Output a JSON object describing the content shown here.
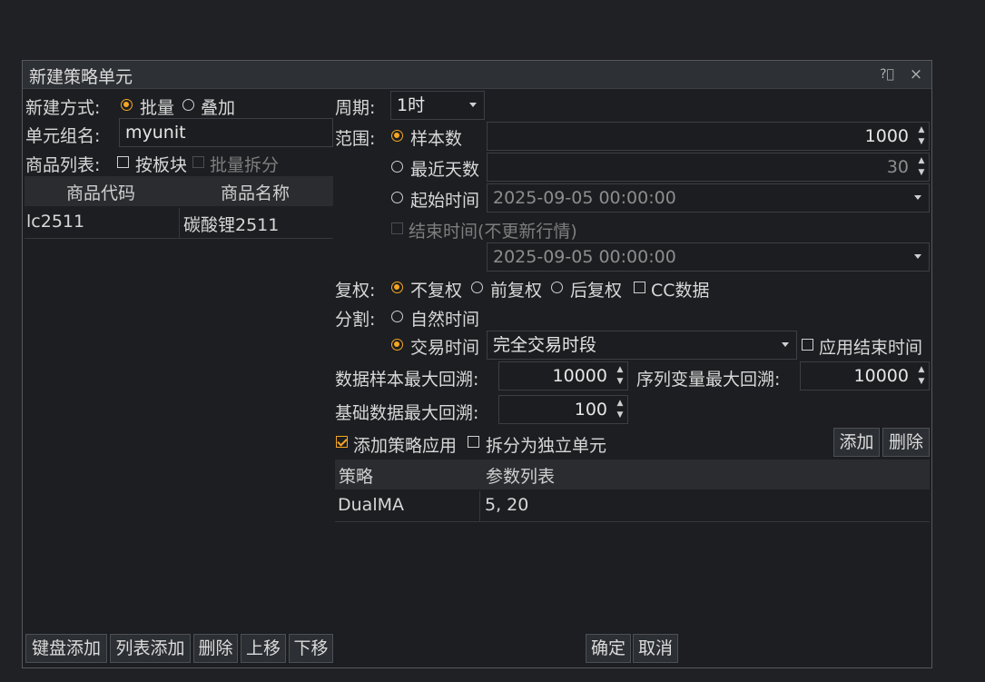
{
  "dialog": {
    "title": "新建策略单元"
  },
  "left": {
    "create_mode_label": "新建方式:",
    "mode_batch": "批量",
    "mode_overlay": "叠加",
    "unit_group_label": "单元组名:",
    "unit_group_value": "myunit",
    "product_list_label": "商品列表:",
    "by_sector_label": "按板块",
    "batch_split_label": "批量拆分",
    "table_headers": [
      "商品代码",
      "商品名称"
    ],
    "rows": [
      {
        "code": "lc2511",
        "name": "碳酸锂2511"
      }
    ],
    "buttons": {
      "keyboard_add": "键盘添加",
      "list_add": "列表添加",
      "delete": "删除",
      "move_up": "上移",
      "move_down": "下移"
    }
  },
  "right": {
    "period_label": "周期:",
    "period_value": "1时",
    "range_label": "范围:",
    "sample_count_label": "样本数",
    "sample_count_value": "1000",
    "recent_days_label": "最近天数",
    "recent_days_value": "30",
    "start_time_label": "起始时间",
    "start_time_value": "2025-09-05 00:00:00",
    "end_time_label": "结束时间(不更新行情)",
    "end_time_value": "2025-09-05 00:00:00",
    "adjust_label": "复权:",
    "no_adjust": "不复权",
    "pre_adjust": "前复权",
    "post_adjust": "后复权",
    "cc_data": "CC数据",
    "split_label": "分割:",
    "natural_time": "自然时间",
    "trade_time": "交易时间",
    "trade_session_value": "完全交易时段",
    "apply_end_time": "应用结束时间",
    "data_sample_max_label": "数据样本最大回溯:",
    "data_sample_max_value": "10000",
    "series_var_max_label": "序列变量最大回溯:",
    "series_var_max_value": "10000",
    "base_data_max_label": "基础数据最大回溯:",
    "base_data_max_value": "100",
    "add_strategy_app": "添加策略应用",
    "split_independent": "拆分为独立单元",
    "add_button": "添加",
    "delete_button": "删除",
    "strategy_headers": [
      "策略",
      "参数列表"
    ],
    "strategies": [
      {
        "name": "DualMA",
        "params": "5, 20"
      }
    ]
  },
  "footer": {
    "ok": "确定",
    "cancel": "取消"
  },
  "colors": {
    "accent": "#f5a623",
    "background": "#1c1e21",
    "titlebar": "#2d3034"
  }
}
